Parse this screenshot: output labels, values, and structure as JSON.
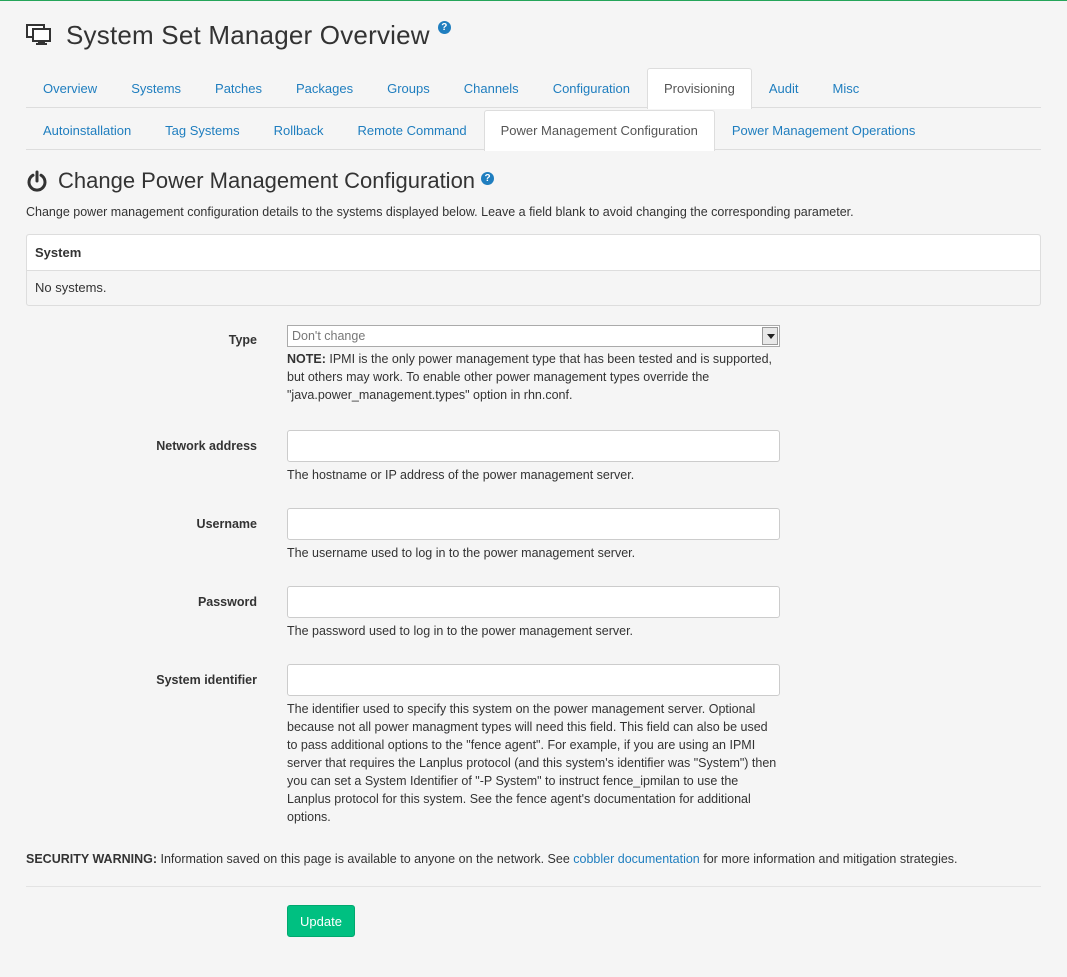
{
  "header": {
    "title": "System Set Manager Overview",
    "help_icon": "?"
  },
  "tabs_primary": [
    {
      "label": "Overview"
    },
    {
      "label": "Systems"
    },
    {
      "label": "Patches"
    },
    {
      "label": "Packages"
    },
    {
      "label": "Groups"
    },
    {
      "label": "Channels"
    },
    {
      "label": "Configuration"
    },
    {
      "label": "Provisioning",
      "active": true
    },
    {
      "label": "Audit"
    },
    {
      "label": "Misc"
    }
  ],
  "tabs_secondary": [
    {
      "label": "Autoinstallation"
    },
    {
      "label": "Tag Systems"
    },
    {
      "label": "Rollback"
    },
    {
      "label": "Remote Command"
    },
    {
      "label": "Power Management Configuration",
      "active": true
    },
    {
      "label": "Power Management Operations"
    }
  ],
  "section": {
    "title": "Change Power Management Configuration",
    "help_icon": "?",
    "intro": "Change power management configuration details to the systems displayed below. Leave a field blank to avoid changing the corresponding parameter."
  },
  "systems_table": {
    "header": "System",
    "empty": "No systems."
  },
  "form": {
    "type": {
      "label": "Type",
      "selected": "Don't change",
      "note_bold": "NOTE:",
      "note": " IPMI is the only power management type that has been tested and is supported, but others may work. To enable other power management types override the \"java.power_management.types\" option in rhn.conf."
    },
    "network_address": {
      "label": "Network address",
      "value": "",
      "help": "The hostname or IP address of the power management server."
    },
    "username": {
      "label": "Username",
      "value": "",
      "help": "The username used to log in to the power management server."
    },
    "password": {
      "label": "Password",
      "value": "",
      "help": "The password used to log in to the power management server."
    },
    "system_identifier": {
      "label": "System identifier",
      "value": "",
      "help": "The identifier used to specify this system on the power management server. Optional because not all power managment types will need this field. This field can also be used to pass additional options to the \"fence agent\". For example, if you are using an IPMI server that requires the Lanplus protocol (and this system's identifier was \"System\") then you can set a System Identifier of \"-P System\" to instruct fence_ipmilan to use the Lanplus protocol for this system. See the fence agent's documentation for additional options."
    }
  },
  "warning": {
    "bold": "SECURITY WARNING:",
    "before": " Information saved on this page is available to anyone on the network. See ",
    "link": "cobbler documentation",
    "after": " for more information and mitigation strategies."
  },
  "update_button": "Update",
  "colors": {
    "accent_link": "#1f7ebf",
    "button_green": "#00c081",
    "top_border": "#25a55a"
  }
}
